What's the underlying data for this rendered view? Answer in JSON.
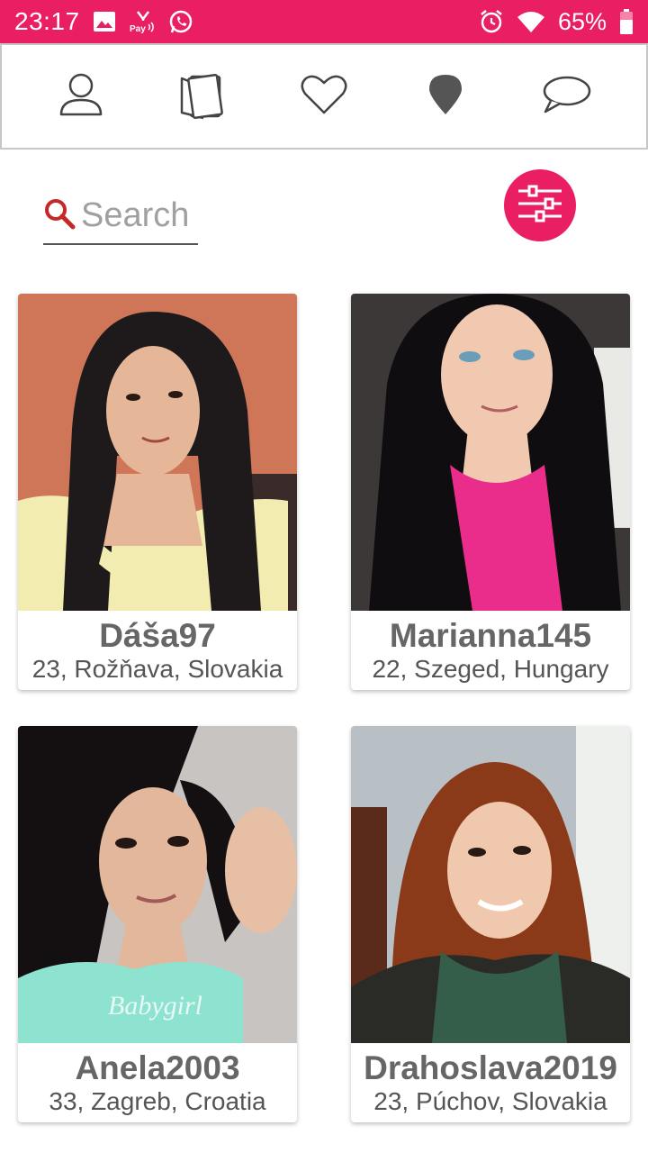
{
  "status_bar": {
    "time": "23:17",
    "battery": "65%",
    "icons": [
      "image-icon",
      "pay-icon",
      "whatsapp-icon",
      "alarm-icon",
      "wifi-icon",
      "battery-icon"
    ],
    "background": "#e91e63"
  },
  "tabs": [
    {
      "name": "profile-icon"
    },
    {
      "name": "cards-icon"
    },
    {
      "name": "heart-icon"
    },
    {
      "name": "location-pin-icon"
    },
    {
      "name": "chat-icon"
    }
  ],
  "search": {
    "placeholder": "Search",
    "value": ""
  },
  "filter_button": {
    "icon": "sliders-icon",
    "color": "#e91e63"
  },
  "profiles": [
    {
      "name": "Dáša97",
      "info": "23, Rožňava, Slovakia"
    },
    {
      "name": "Marianna145",
      "info": "22, Szeged, Hungary"
    },
    {
      "name": "Anela2003",
      "info": "33, Zagreb, Croatia"
    },
    {
      "name": "Drahoslava2019",
      "info": "23, Púchov, Slovakia"
    }
  ],
  "accent_color": "#e91e63"
}
